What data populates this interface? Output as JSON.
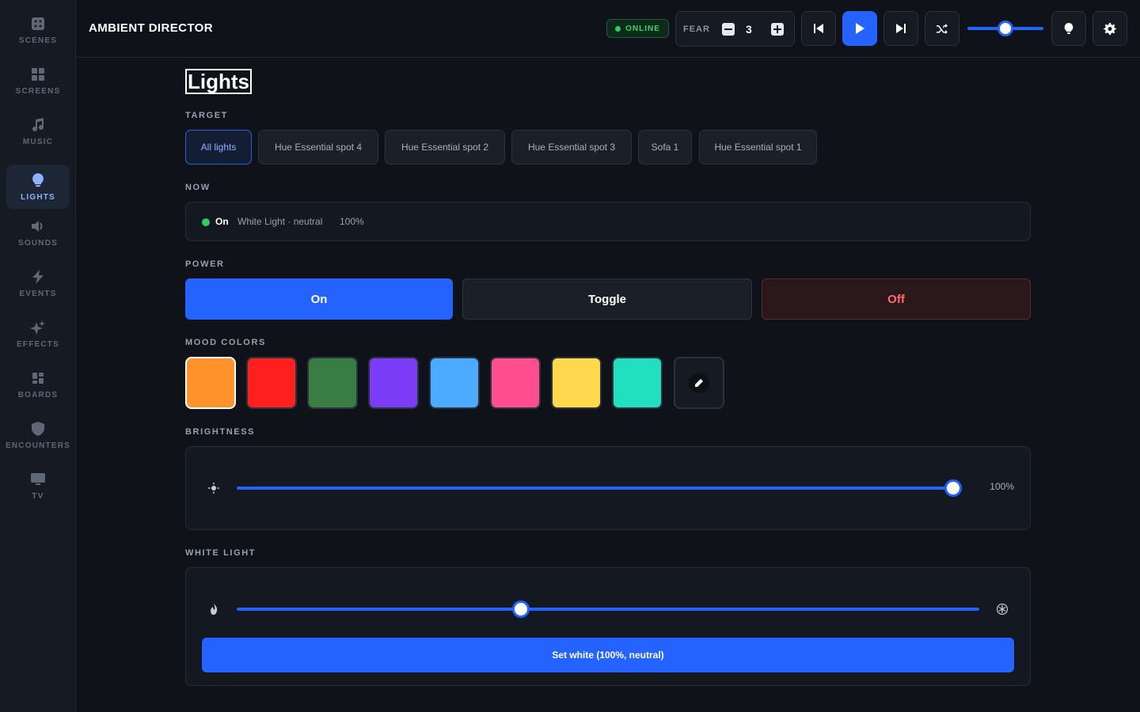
{
  "app": {
    "title": "AMBIENT DIRECTOR"
  },
  "sidebar": {
    "items": [
      {
        "id": "scenes",
        "label": "SCENES",
        "icon": "scenes-icon",
        "active": false
      },
      {
        "id": "screens",
        "label": "SCREENS",
        "icon": "grid-icon",
        "active": false
      },
      {
        "id": "music",
        "label": "MUSIC",
        "icon": "music-note-icon",
        "active": false
      },
      {
        "id": "lights",
        "label": "LIGHTS",
        "icon": "lightbulb-icon",
        "active": true
      },
      {
        "id": "sounds",
        "label": "SOUNDS",
        "icon": "speaker-icon",
        "active": false
      },
      {
        "id": "events",
        "label": "EVENTS",
        "icon": "bolt-icon",
        "active": false
      },
      {
        "id": "effects",
        "label": "EFFECTS",
        "icon": "sparkles-icon",
        "active": false
      },
      {
        "id": "boards",
        "label": "BOARDS",
        "icon": "dashboard-icon",
        "active": false
      },
      {
        "id": "encounters",
        "label": "ENCOUNTERS",
        "icon": "shield-icon",
        "active": false
      },
      {
        "id": "tv",
        "label": "TV",
        "icon": "monitor-icon",
        "active": false
      }
    ]
  },
  "header": {
    "status": "ONLINE",
    "fear": {
      "label": "FEAR",
      "value": "3"
    },
    "volume": 0.5,
    "colors": {
      "accent": "#2563ff",
      "online": "#2ecc62"
    }
  },
  "lights": {
    "title": "Lights",
    "target_label": "TARGET",
    "targets": [
      {
        "label": "All lights",
        "active": true
      },
      {
        "label": "Hue Essential spot 4",
        "active": false
      },
      {
        "label": "Hue Essential spot 2",
        "active": false
      },
      {
        "label": "Hue Essential spot 3",
        "active": false
      },
      {
        "label": "Sofa 1",
        "active": false
      },
      {
        "label": "Hue Essential spot 1",
        "active": false
      }
    ],
    "now_label": "NOW",
    "now": {
      "state": "On",
      "description": "White Light · neutral",
      "brightness": "100%"
    },
    "power_label": "POWER",
    "power": {
      "on": "On",
      "toggle": "Toggle",
      "off": "Off"
    },
    "mood_label": "MOOD COLORS",
    "mood_colors": [
      "#ff922b",
      "#ff1f1f",
      "#3a7d44",
      "#7b3cf7",
      "#4dabff",
      "#ff4d8d",
      "#ffd84d",
      "#22e0bf"
    ],
    "mood_selected": 0,
    "brightness_label": "BRIGHTNESS",
    "brightness": {
      "value": 1.0,
      "display": "100%"
    },
    "white_label": "WHITE LIGHT",
    "white": {
      "value": 0.383
    },
    "set_white_label": "Set white (100%, neutral)"
  }
}
